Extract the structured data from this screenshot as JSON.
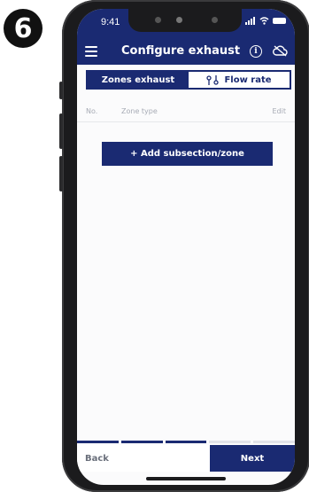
{
  "step": "6",
  "status": {
    "time": "9:41"
  },
  "header": {
    "title": "Configure exhaust",
    "info_icon": "info-icon",
    "cloud_icon": "cloud-off-icon"
  },
  "tabs": [
    {
      "label": "Zones exhaust",
      "active": true
    },
    {
      "label": "Flow rate",
      "active": false,
      "icon": "flow-icon"
    }
  ],
  "table": {
    "columns": [
      "No.",
      "Zone type",
      "Edit"
    ]
  },
  "actions": {
    "add_label": "+ Add subsection/zone"
  },
  "footer": {
    "back_label": "Back",
    "next_label": "Next"
  },
  "colors": {
    "primary": "#1a2a72",
    "muted": "#a7abb5",
    "background": "#fbfbfc"
  }
}
